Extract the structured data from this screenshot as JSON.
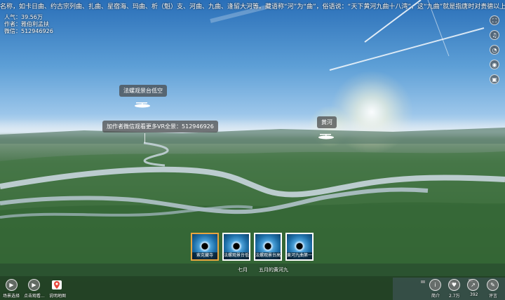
{
  "marquee": {
    "text": "名称，如卡日曲、约古宗列曲、扎曲、星宿海、玛曲、析（魁）支、河曲、九曲、逢留大河等。藏语称“河”为“曲”，俗语说：“天下黄河九曲十八湾”，这“九曲”就是指唐时对贵德以上黄河段的称呼 黄河首曲所在地玛曲县以至整个黄河流域地"
  },
  "info": {
    "popularity": "人气：39.56万",
    "author": "作者：雅伯利孟扶",
    "wechat": "微信：512946926"
  },
  "hotspots": {
    "h1_label": "法螺观景台低空",
    "h2_label": "黄河",
    "tip": "加作者微信观看更多VR全景：512946926"
  },
  "right_bar": [
    {
      "icon": "fullscreen-icon",
      "glyph": "⛶"
    },
    {
      "icon": "music-icon",
      "glyph": "♫"
    },
    {
      "icon": "gyroscope-icon",
      "glyph": "◔"
    },
    {
      "icon": "view-mode-icon",
      "glyph": "◉"
    },
    {
      "icon": "vr-icon",
      "glyph": "▣"
    }
  ],
  "scenes": [
    {
      "label": "索克藏寺",
      "active": true
    },
    {
      "label": "法螺观景台低...",
      "active": false
    },
    {
      "label": "法螺观景台高",
      "active": false
    },
    {
      "label": "黄河九曲第一...",
      "active": false
    }
  ],
  "groups": {
    "g1": "七月",
    "g2": "五月的黄河九"
  },
  "bottom_left": {
    "scene_select": "场景选择",
    "tap_view": "点击观看...",
    "map": "说明地图"
  },
  "bottom_right": {
    "intro": "简介",
    "likes": "2.7万",
    "shares": "392",
    "comments": "评言"
  },
  "colors": {
    "active_thumb": "#e8a640"
  }
}
